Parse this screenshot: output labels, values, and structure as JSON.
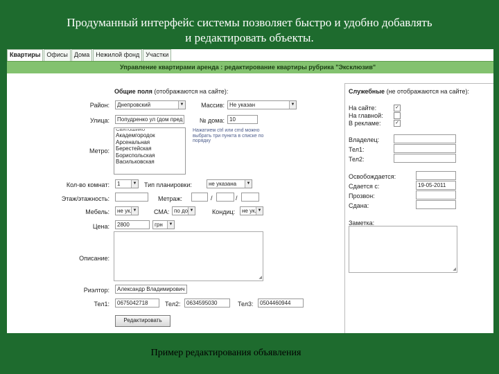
{
  "slide": {
    "title_line1": "Продуманный интерфейс системы позволяет быстро и удобно добавлять",
    "title_line2": "и редактировать объекты.",
    "caption": "Пример редактирования объявления"
  },
  "tabs": [
    "Квартиры",
    "Офисы",
    "Дома",
    "Нежилой фонд",
    "Участки"
  ],
  "header": {
    "title": "Управление квартирами аренда : редактирование квартиры рубрика \"Эксклюзив\""
  },
  "form": {
    "common_title": "Общие поля",
    "common_note": "(отображаются на сайте):",
    "raion_label": "Район:",
    "raion_value": "Днепровский",
    "massiv_label": "Массив:",
    "massiv_value": "Не указан",
    "street_label": "Улица:",
    "street_value": "Попудренко ул (дом пред",
    "house_label": "№ дома:",
    "house_value": "10",
    "metro_label": "Метро:",
    "metro_options": [
      "Академгородок",
      "Арсенальная",
      "Берестейская",
      "Бориспольская",
      "Васильковская"
    ],
    "metro_first_partial": "Святошино",
    "metro_hint": "Нажатием ctrl или cmd можно выбрать три пункта в списке по порядку",
    "rooms_label": "Кол-во комнат:",
    "rooms_value": "1",
    "plan_label": "Тип планировки:",
    "plan_value": "не указана",
    "floor_label": "Этаж/этажность:",
    "area_label": "Метраж:",
    "slash": "/",
    "furniture_label": "Мебель:",
    "furniture_value": "не ук.",
    "sma_label": "СМА:",
    "sma_value": "по дог",
    "cond_label": "Кондиц:",
    "cond_value": "не ук.",
    "price_label": "Цена:",
    "price_value": "2800",
    "currency_value": "грн",
    "desc_label": "Описание:",
    "realtor_label": "Риэлтор:",
    "realtor_value": "Александр Владимирович",
    "tel1_label": "Тел1:",
    "tel1_value": "0675042718",
    "tel2_label": "Тел2:",
    "tel2_value": "0634595030",
    "tel3_label": "Тел3:",
    "tel3_value": "0504460944",
    "submit_label": "Редактировать"
  },
  "service": {
    "title": "Служебные",
    "note": "(не отображаются на сайте):",
    "on_site_label": "На сайте:",
    "on_site_checked": true,
    "main_label": "На главной:",
    "main_checked": false,
    "ads_label": "В рекламе:",
    "ads_checked": true,
    "owner_label": "Владелец:",
    "tel1_label": "Тел1:",
    "tel2_label": "Тел2:",
    "free_label": "Освобождается:",
    "rent_label": "Сдается с:",
    "rent_value": "19-05-2011",
    "call_label": "Прозвон:",
    "given_label": "Сдана:",
    "note_label": "Заметка:"
  },
  "colors": {
    "slide_bg": "#1e6b2e",
    "header_bar": "#83c26f",
    "checkmark": "✓"
  }
}
